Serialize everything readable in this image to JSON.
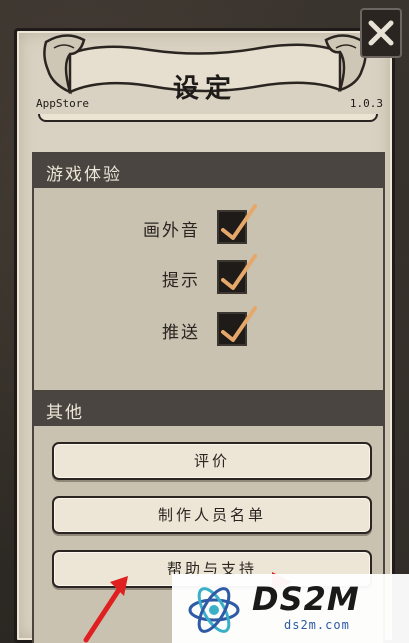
{
  "header": {
    "title": "设定",
    "store": "AppStore",
    "version": "1.0.3"
  },
  "sections": {
    "experience": {
      "title": "游戏体验",
      "toggles": [
        {
          "label": "画外音",
          "checked": true
        },
        {
          "label": "提示",
          "checked": true
        },
        {
          "label": "推送",
          "checked": true
        }
      ]
    },
    "other": {
      "title": "其他",
      "buttons": [
        {
          "label": "评价"
        },
        {
          "label": "制作人员名单"
        },
        {
          "label": "帮助与支持"
        }
      ]
    }
  },
  "icons": {
    "close": "close-x-icon",
    "check": "checkmark-icon",
    "annotation": "red-arrow-icon"
  },
  "colors": {
    "panel": "#d9d2c2",
    "section_header": "#4a4540",
    "check": "#e5a86a",
    "annotation_arrow": "#e02020",
    "watermark_blue": "#2e5aa6"
  },
  "watermark": {
    "brand": "DS2M",
    "url": "ds2m.com"
  }
}
